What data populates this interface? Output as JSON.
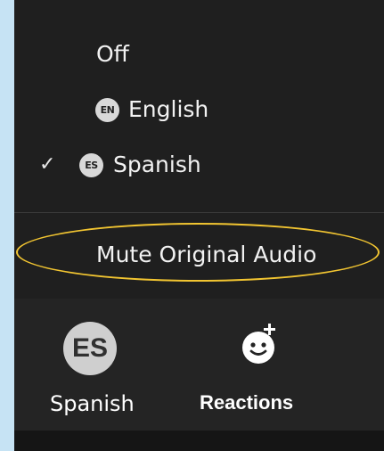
{
  "language_menu": {
    "items": [
      {
        "label": "Off",
        "badge": "",
        "checked": false
      },
      {
        "label": "English",
        "badge": "EN",
        "checked": false
      },
      {
        "label": "Spanish",
        "badge": "ES",
        "checked": true
      }
    ],
    "check_mark": "✓",
    "mute_label": "Mute Original Audio",
    "highlight_color": "#f2c531"
  },
  "toolbar": {
    "interpretation": {
      "avatar_text": "ES",
      "label": "Spanish"
    },
    "reactions": {
      "label": "Reactions",
      "icon": "smile-plus-icon"
    }
  }
}
